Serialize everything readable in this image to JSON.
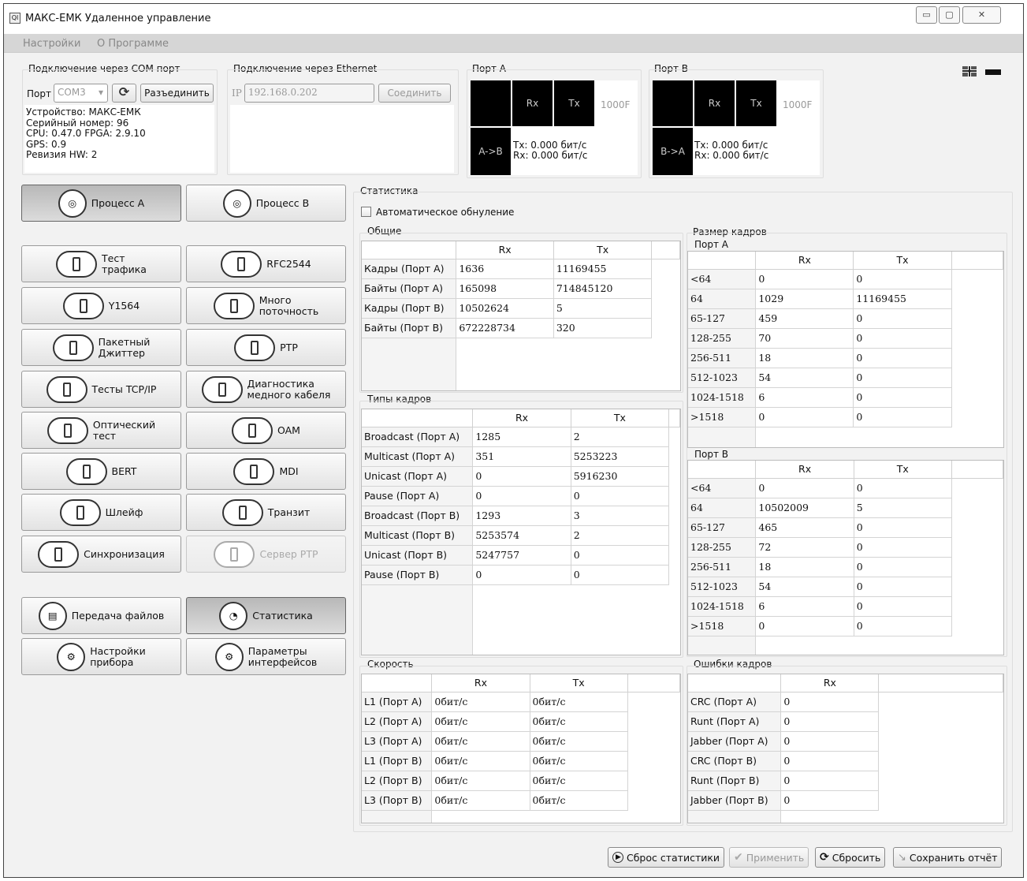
{
  "window": {
    "title": "МАКС-ЕМК Удаленное управление",
    "app_icon": "Ql",
    "min_label": "▭",
    "max_label": "▢",
    "close_label": "✕"
  },
  "menu": [
    "Настройки",
    "О Программе"
  ],
  "com": {
    "title": "Подключение через COM порт",
    "port_label": "Порт",
    "port_value": "COM3",
    "disconnect_label": "Разъединить",
    "info": [
      "Устройство: МАКС-ЕМК",
      "Серийный номер: 96",
      "CPU: 0.47.0 FPGA: 2.9.10",
      "GPS: 0.9",
      "Ревизия HW: 2"
    ]
  },
  "eth": {
    "title": "Подключение через Ethernet",
    "ip_label": "IP",
    "ip_value": "192.168.0.202",
    "connect_label": "Соединить"
  },
  "portA": {
    "title": "Порт A",
    "rx": "Rx",
    "tx": "Tx",
    "speed": "1000F",
    "dir": "A->B",
    "tx_rate": "Tx: 0.000 бит/с",
    "rx_rate": "Rx: 0.000 бит/с"
  },
  "portB": {
    "title": "Порт B",
    "rx": "Rx",
    "tx": "Tx",
    "speed": "1000F",
    "dir": "B->A",
    "tx_rate": "Tx: 0.000 бит/с",
    "rx_rate": "Rx: 0.000 бит/с"
  },
  "buttons": {
    "proc_a": "Процесс A",
    "proc_b": "Процесс B",
    "traffic": "Тест\nтрафика",
    "rfc": "RFC2544",
    "y1564": "Y1564",
    "multi": "Много\nпоточность",
    "jitter": "Пакетный\nДжиттер",
    "ptp": "PTP",
    "tcpip": "Тесты TCP/IP",
    "copper": "Диагностика\nмедного кабеля",
    "optic": "Оптический\nтест",
    "oam": "OAM",
    "bert": "BERT",
    "mdi": "MDI",
    "loop": "Шлейф",
    "transit": "Транзит",
    "sync": "Синхронизация",
    "ptp_server": "Сервер PTP",
    "files": "Передача файлов",
    "stats": "Статистика",
    "settings": "Настройки\nприбора",
    "params": "Параметры\nинтерфейсов"
  },
  "stats": {
    "title": "Статистика",
    "auto_reset": "Автоматическое обнуление",
    "general": {
      "title": "Общие",
      "headers": [
        "Rx",
        "Tx"
      ],
      "rows": [
        [
          "Кадры (Порт A)",
          "1636",
          "11169455"
        ],
        [
          "Байты (Порт A)",
          "165098",
          "714845120"
        ],
        [
          "Кадры (Порт B)",
          "10502624",
          "5"
        ],
        [
          "Байты (Порт B)",
          "672228734",
          "320"
        ]
      ]
    },
    "types": {
      "title": "Типы кадров",
      "headers": [
        "Rx",
        "Tx"
      ],
      "rows": [
        [
          "Broadcast (Порт A)",
          "1285",
          "2"
        ],
        [
          "Multicast (Порт A)",
          "351",
          "5253223"
        ],
        [
          "Unicast (Порт A)",
          "0",
          "5916230"
        ],
        [
          "Pause (Порт A)",
          "0",
          "0"
        ],
        [
          "Broadcast (Порт B)",
          "1293",
          "3"
        ],
        [
          "Multicast (Порт B)",
          "5253574",
          "2"
        ],
        [
          "Unicast (Порт B)",
          "5247757",
          "0"
        ],
        [
          "Pause (Порт B)",
          "0",
          "0"
        ]
      ]
    },
    "speed": {
      "title": "Скорость",
      "headers": [
        "Rx",
        "Tx"
      ],
      "rows": [
        [
          "L1 (Порт A)",
          "0бит/с",
          "0бит/с"
        ],
        [
          "L2 (Порт A)",
          "0бит/с",
          "0бит/с"
        ],
        [
          "L3 (Порт A)",
          "0бит/с",
          "0бит/с"
        ],
        [
          "L1 (Порт B)",
          "0бит/с",
          "0бит/с"
        ],
        [
          "L2 (Порт B)",
          "0бит/с",
          "0бит/с"
        ],
        [
          "L3 (Порт B)",
          "0бит/с",
          "0бит/с"
        ]
      ]
    },
    "sizes": {
      "title": "Размер кадров",
      "portA_title": "Порт A",
      "portB_title": "Порт B",
      "headers": [
        "Rx",
        "Tx"
      ],
      "portA_rows": [
        [
          "<64",
          "0",
          "0"
        ],
        [
          "64",
          "1029",
          "11169455"
        ],
        [
          "65-127",
          "459",
          "0"
        ],
        [
          "128-255",
          "70",
          "0"
        ],
        [
          "256-511",
          "18",
          "0"
        ],
        [
          "512-1023",
          "54",
          "0"
        ],
        [
          "1024-1518",
          "6",
          "0"
        ],
        [
          ">1518",
          "0",
          "0"
        ]
      ],
      "portB_rows": [
        [
          "<64",
          "0",
          "0"
        ],
        [
          "64",
          "10502009",
          "5"
        ],
        [
          "65-127",
          "465",
          "0"
        ],
        [
          "128-255",
          "72",
          "0"
        ],
        [
          "256-511",
          "18",
          "0"
        ],
        [
          "512-1023",
          "54",
          "0"
        ],
        [
          "1024-1518",
          "6",
          "0"
        ],
        [
          ">1518",
          "0",
          "0"
        ]
      ]
    },
    "errors": {
      "title": "Ошибки кадров",
      "headers": [
        "Rx"
      ],
      "rows": [
        [
          "CRC (Порт A)",
          "0"
        ],
        [
          "Runt (Порт A)",
          "0"
        ],
        [
          "Jabber (Порт A)",
          "0"
        ],
        [
          "CRC (Порт B)",
          "0"
        ],
        [
          "Runt (Порт B)",
          "0"
        ],
        [
          "Jabber (Порт B)",
          "0"
        ]
      ]
    }
  },
  "bottom": {
    "reset_stats": "Сброс статистики",
    "apply": "Применить",
    "reset": "Сбросить",
    "save_report": "Сохранить отчёт"
  },
  "icons": {
    "flag": "uk-flag-icon",
    "minus": "collapse-icon",
    "refresh": "refresh-icon"
  }
}
